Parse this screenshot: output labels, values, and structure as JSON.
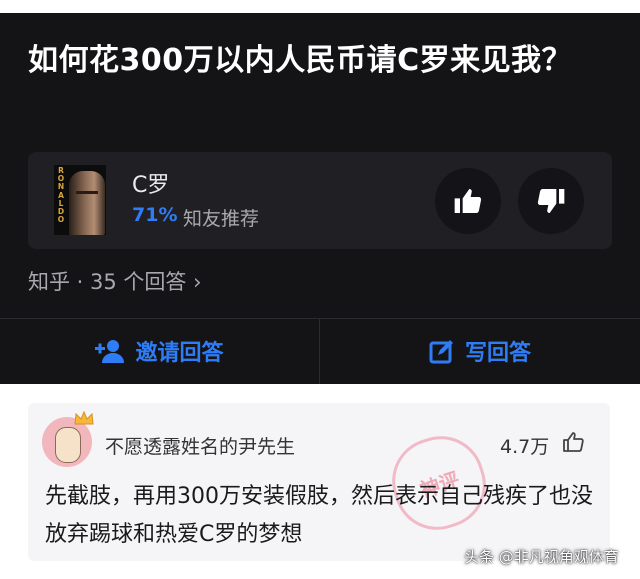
{
  "question": {
    "title": "如何花300万以内人民币请C罗来见我？"
  },
  "topic_card": {
    "name": "C罗",
    "percent": "71%",
    "recommend_label": "知友推荐",
    "poster_text": "RONALDO",
    "upvote_icon": "thumbs-up-icon",
    "downvote_icon": "thumbs-down-icon"
  },
  "meta": {
    "source_and_count": "知乎 · 35 个回答 ›"
  },
  "actions": {
    "invite_label": "邀请回答",
    "write_label": "写回答"
  },
  "comment": {
    "username": "不愿透露姓名的尹先生",
    "likes": "4.7万",
    "stamp_text": "神评",
    "text": "先截肢，再用300万安装假肢，然后表示自己残疾了也没放弃踢球和热爱C罗的梦想"
  },
  "watermark": "头条 @非凡视角观体育",
  "colors": {
    "accent": "#2f7df6",
    "dark_bg": "#141417",
    "card_bg": "#1f1f24"
  }
}
